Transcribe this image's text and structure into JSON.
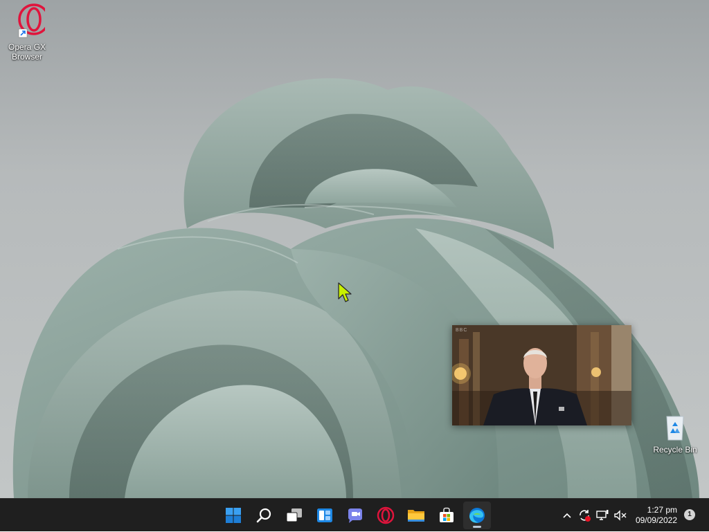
{
  "desktop": {
    "icons": [
      {
        "label": "Opera GX Browser",
        "icon": "opera-gx-icon"
      },
      {
        "label": "Recycle Bin",
        "icon": "recycle-bin-icon"
      }
    ]
  },
  "pip": {
    "watermark": "BBC",
    "content": "video-thumbnail"
  },
  "taskbar": {
    "apps": [
      {
        "name": "Start",
        "icon": "windows-start-icon"
      },
      {
        "name": "Search",
        "icon": "search-icon"
      },
      {
        "name": "Task View",
        "icon": "task-view-icon"
      },
      {
        "name": "Widgets",
        "icon": "widgets-icon"
      },
      {
        "name": "Chat",
        "icon": "teams-chat-icon"
      },
      {
        "name": "Opera GX",
        "icon": "opera-gx-icon"
      },
      {
        "name": "File Explorer",
        "icon": "file-explorer-icon"
      },
      {
        "name": "Microsoft Store",
        "icon": "store-icon"
      },
      {
        "name": "Microsoft Edge",
        "icon": "edge-icon",
        "active": true
      }
    ],
    "tray_icons": [
      "chevron-up-icon",
      "sync-icon",
      "network-icon",
      "volume-muted-icon"
    ],
    "clock": {
      "time": "1:27 pm",
      "date": "09/09/2022"
    },
    "notification_count": "1"
  },
  "colors": {
    "taskbar": "#1f1f1f",
    "wallpaper_base": "#b6babb",
    "bloom": "#8ea69e",
    "opera_red": "#e0143c",
    "cursor": "#c8f000"
  }
}
